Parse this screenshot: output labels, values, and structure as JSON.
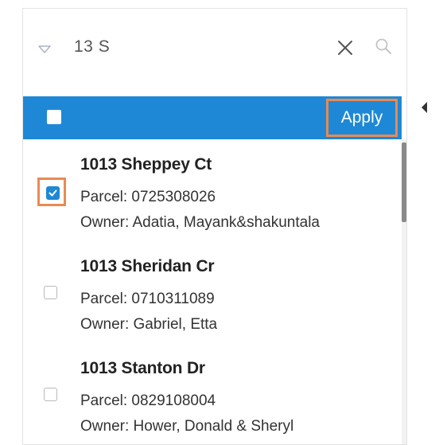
{
  "search": {
    "value": "13 S",
    "filter_icon": "chevron-down-icon",
    "clear_icon": "close-icon",
    "search_icon": "search-icon"
  },
  "header": {
    "select_all_checked": false,
    "apply_label": "Apply"
  },
  "results": [
    {
      "title": "1013 Sheppey Ct",
      "parcel": "Parcel: 0725308026",
      "owner": "Owner: Adatia, Mayank&shakuntala",
      "checked": true
    },
    {
      "title": "1013 Sheridan Cr",
      "parcel": "Parcel: 0710311089",
      "owner": "Owner: Gabriel, Etta",
      "checked": false
    },
    {
      "title": "1013 Stanton Dr",
      "parcel": "Parcel: 0829108004",
      "owner": "Owner: Hower, Donald & Sheryl",
      "checked": false
    }
  ],
  "colors": {
    "accent": "#1e88d6",
    "highlight": "#ea8a52"
  }
}
